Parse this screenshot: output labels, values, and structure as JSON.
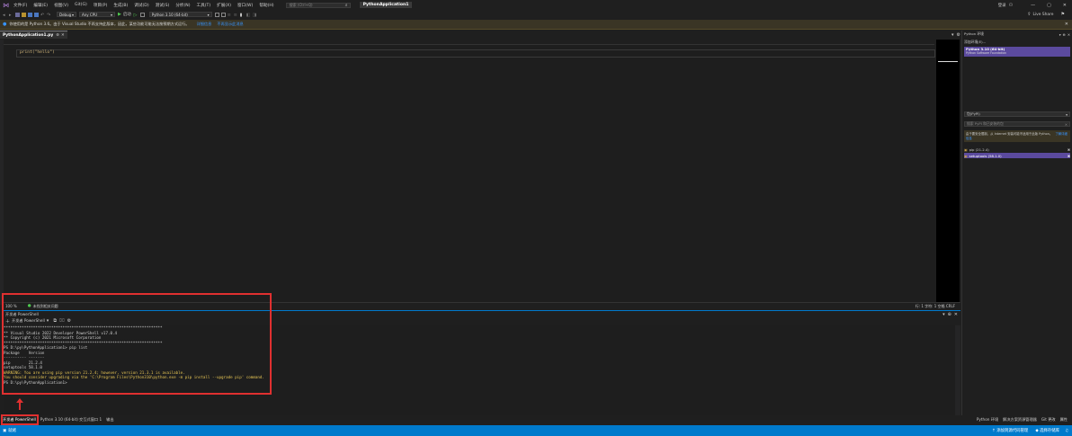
{
  "menu": [
    "文件(F)",
    "编辑(E)",
    "视图(V)",
    "Git(G)",
    "项目(P)",
    "生成(B)",
    "调试(D)",
    "测试(S)",
    "分析(N)",
    "工具(T)",
    "扩展(X)",
    "窗口(W)",
    "帮助(H)"
  ],
  "search": {
    "placeholder": "搜索 (Ctrl+Q)"
  },
  "project_name": "PythonApplication1",
  "title_right": {
    "user": "登录",
    "live_share": "Live Share"
  },
  "toolbar": {
    "config": "Debug",
    "platform": "Any CPU",
    "start": "启动",
    "env": "Python 3.10 (64-bit)"
  },
  "infobar": {
    "message": "你使用的是 Python 3.6。由于 Visual Studio 不再支持此版本，因此，某些功能可能无法按预期方式运行。",
    "link1": "详细信息",
    "link2": "不再显示此消息"
  },
  "editor": {
    "tab": "PythonApplication1.py",
    "code": "print(\"hello\")",
    "zoom": "100 %",
    "issues": "未找到相关问题",
    "pos": "行: 1  字符: 1  空格  CRLF"
  },
  "terminal": {
    "title": "开发者 PowerShell",
    "tool_label": "开发者 PowerShell",
    "lines": [
      "**********************************************************************",
      "** Visual Studio 2022 Developer PowerShell v17.0.4",
      "** Copyright (c) 2021 Microsoft Corporation",
      "**********************************************************************",
      "PS D:\\py\\PythonApplication1> pip list",
      "Package    Version",
      "---------- -------",
      "pip        21.2.4",
      "setuptools 58.1.0"
    ],
    "warn_lines": [
      "WARNING: You are using pip version 21.2.4; however, version 21.3.1 is available.",
      "You should consider upgrading via the 'C:\\Program Files\\Python310\\python.exe -m pip install --upgrade pip' command."
    ],
    "prompt": "PS D:\\py\\PythonApplication1>"
  },
  "bottom_tabs": [
    "开发者 PowerShell",
    "Python 3.10 (64-bit) 交互式窗口 1",
    "输出"
  ],
  "status": {
    "left": "就绪",
    "add_source": "↑ 添加到源代码管理",
    "select_repo": "◆ 选择存储库"
  },
  "right_panel": {
    "title": "Python 环境",
    "add_env": "添加环境(E)...",
    "env_name": "Python 3.10 (64-bit)",
    "env_sub": "Python Software Foundation",
    "pkg_dropdown": "包(PyPI)",
    "pkg_search": "搜索 PyPI 和已安装的包",
    "notice": "由于要安全限制，从 Internet 安装可能不适用于此版 Python。",
    "notice_link": "了解详细信息",
    "pkgs": [
      "pip (21.2.4)",
      "setuptools (58.1.0)"
    ],
    "bottom_tabs": [
      "Python 环境",
      "解决方案资源管理器",
      "Git 更改",
      "属性"
    ]
  }
}
